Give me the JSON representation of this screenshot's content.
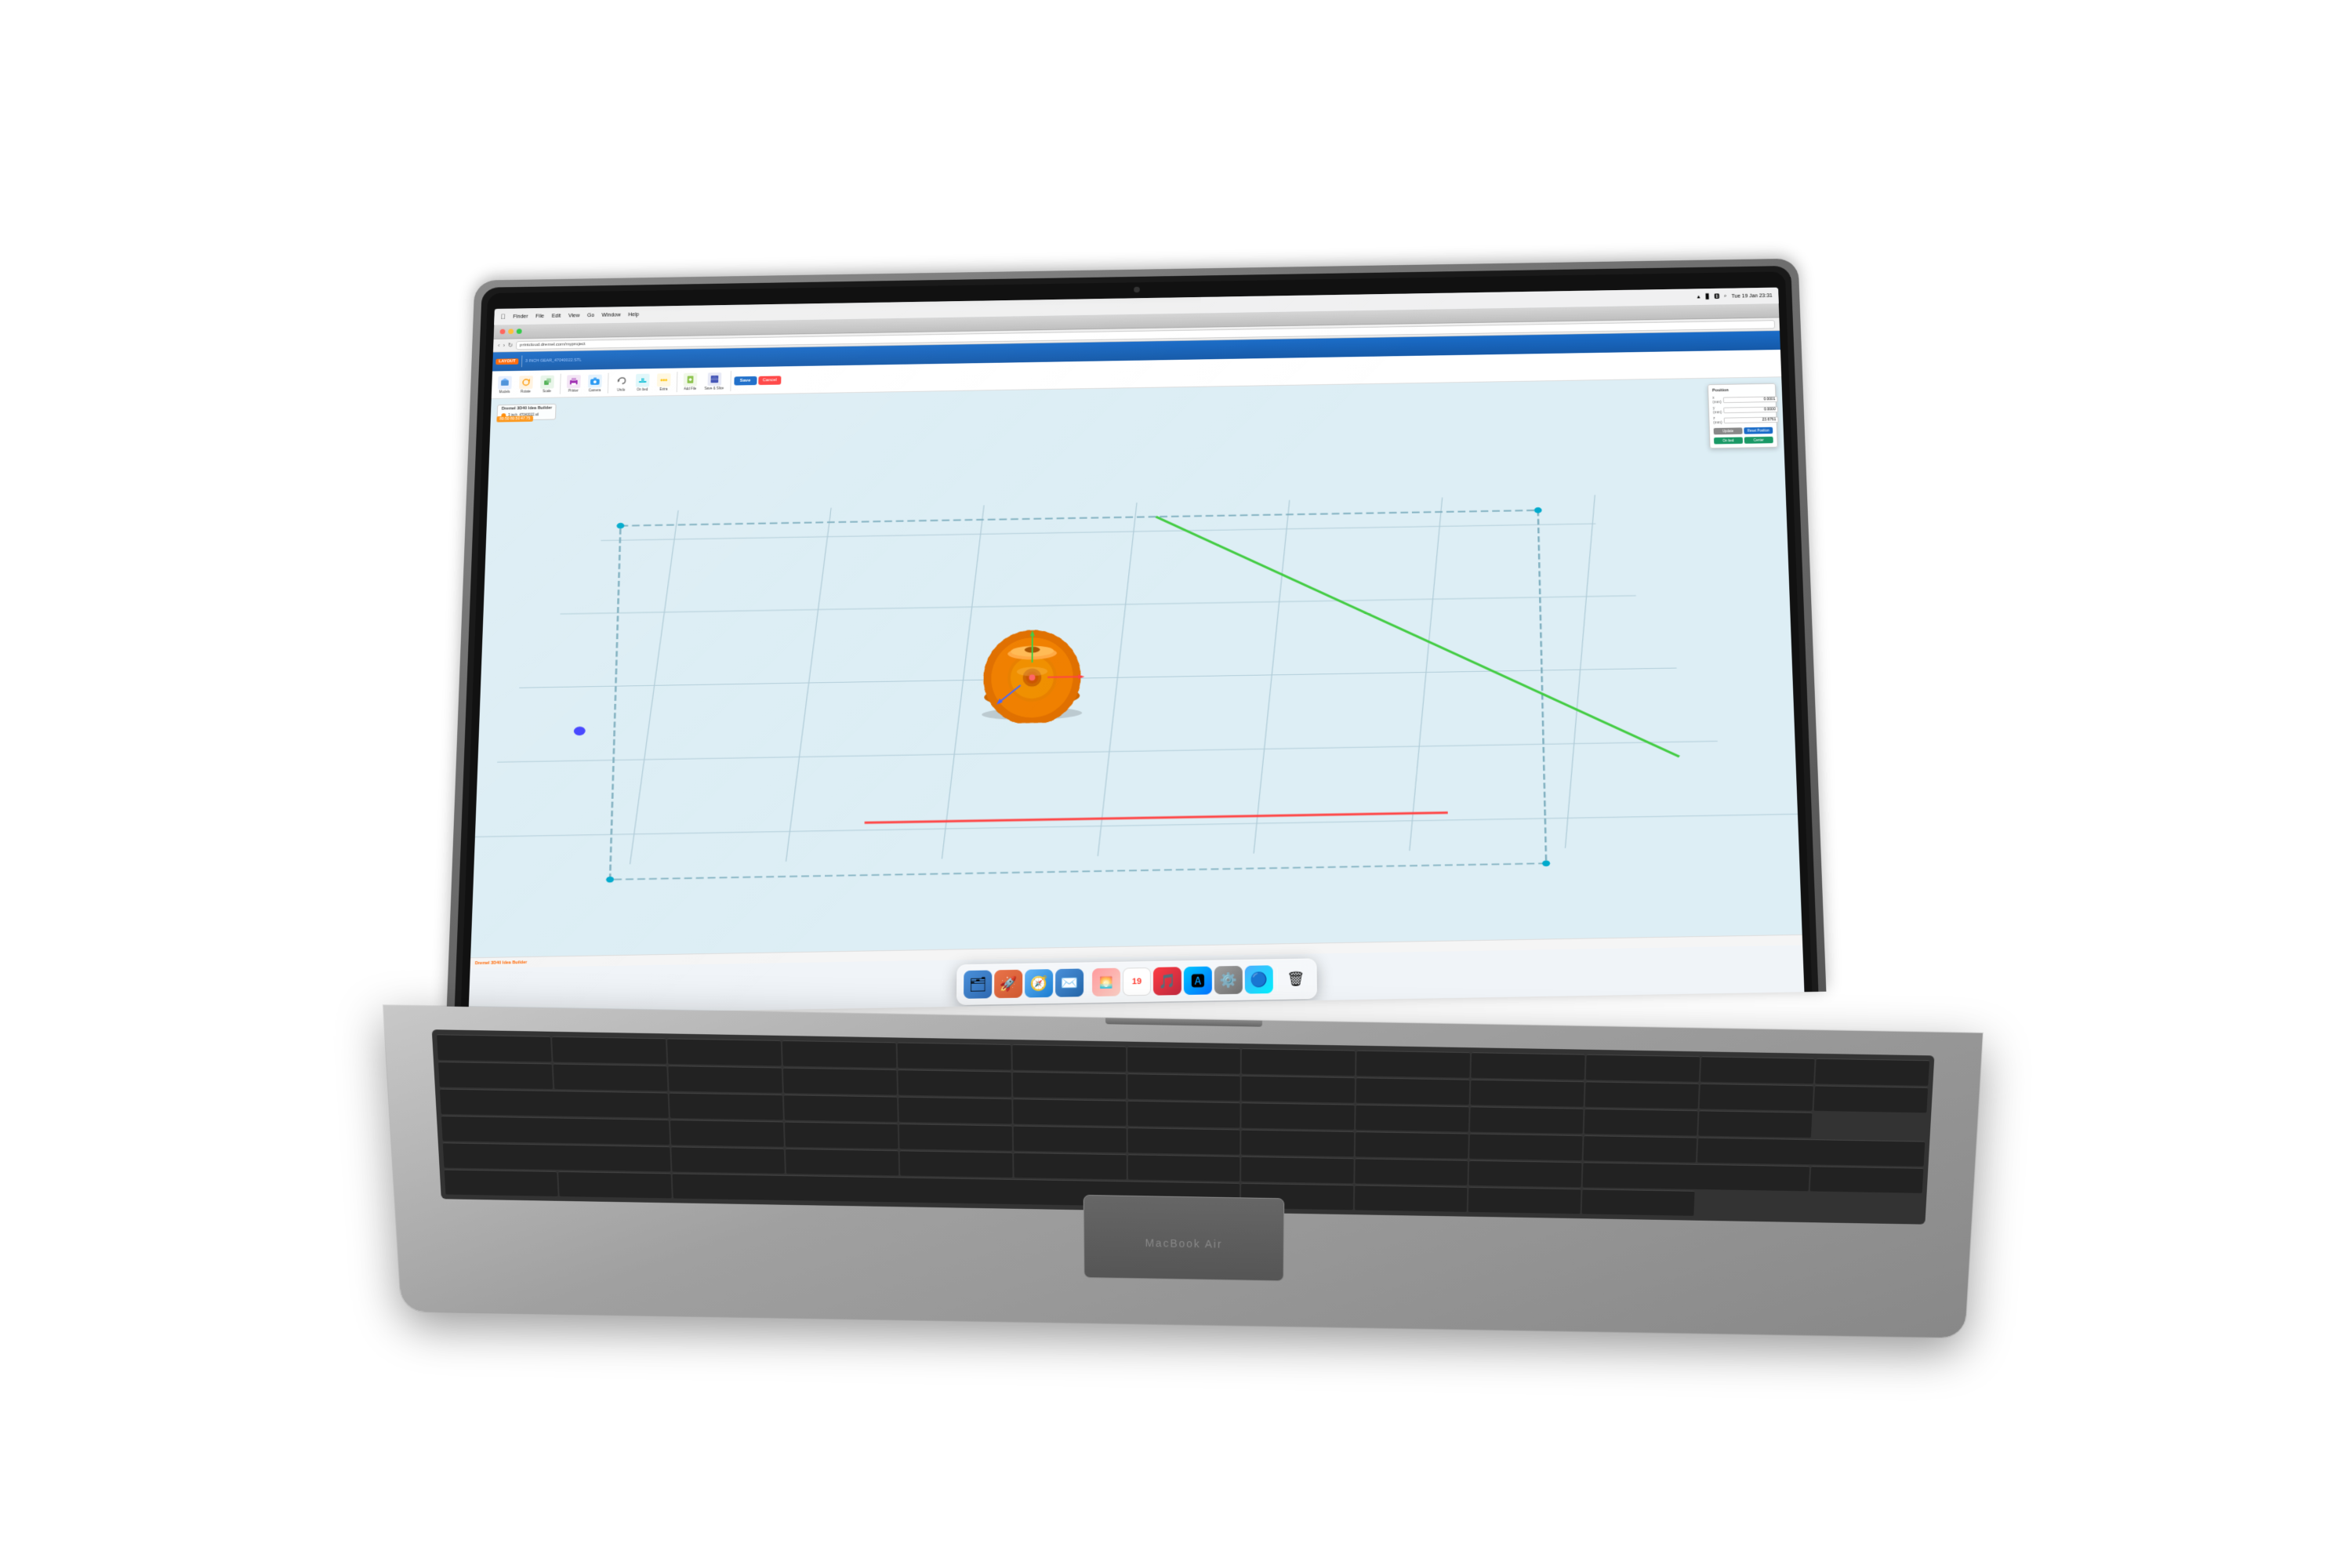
{
  "macbook": {
    "model_label": "MacBook Air",
    "camera_label": "Camera"
  },
  "macos": {
    "time": "Tue 19 Jan 23:31",
    "menubar_items": [
      "Finder",
      "File",
      "Edit",
      "View",
      "Go",
      "Window",
      "Help"
    ],
    "menu_icons": [
      "wifi",
      "battery",
      "bluetooth",
      "search"
    ]
  },
  "browser": {
    "url": "printcloud.dremel.com/myproject",
    "title": "Dremel 3D40 Idea Builder",
    "traffic_lights": [
      "close",
      "minimize",
      "maximize"
    ]
  },
  "dremel_app": {
    "layout_label": "LAYOUT",
    "filename": "3 INCH GEAR_47040022.STL",
    "toolbar_buttons": [
      {
        "id": "models",
        "label": "Models"
      },
      {
        "id": "rotate",
        "label": "Rotate"
      },
      {
        "id": "scale",
        "label": "Scale"
      },
      {
        "id": "printer",
        "label": "Printer"
      },
      {
        "id": "camera",
        "label": "Camera"
      },
      {
        "id": "undo",
        "label": "Undo"
      },
      {
        "id": "on_bed",
        "label": "On bed"
      },
      {
        "id": "extra",
        "label": "Extra"
      },
      {
        "id": "add_file",
        "label": "Add File"
      },
      {
        "id": "save_slice",
        "label": "Save & Slice"
      },
      {
        "id": "save",
        "label": "Save"
      },
      {
        "id": "cancel",
        "label": "Cancel"
      }
    ],
    "position_panel": {
      "title": "Position",
      "x_label": "x (mm)",
      "y_label": "y (mm)",
      "z_label": "z (mm)",
      "x_value": "0.0001",
      "y_value": "0.0000",
      "z_value": "23.6761",
      "update_btn": "Update",
      "preset_btn": "Reset Position",
      "onbed_btn": "On bed",
      "center_btn": "Center"
    },
    "object_name": "3 inch_47040022.stl",
    "dimensions": "80.50  80.50  47.75",
    "builder_bar": "Dremel 3D40 Idea Builder"
  },
  "dock": {
    "icons": [
      {
        "name": "finder",
        "emoji": "🗂",
        "color": "#4a90d9"
      },
      {
        "name": "launchpad",
        "emoji": "🚀",
        "color": "#e8734a"
      },
      {
        "name": "safari",
        "emoji": "🧭",
        "color": "#1a7fd4"
      },
      {
        "name": "mail",
        "emoji": "✉️",
        "color": "#4a90d9"
      },
      {
        "name": "photos",
        "emoji": "🌅",
        "color": "#e8734a"
      },
      {
        "name": "calendar",
        "emoji": "📅",
        "color": "#ff3b30"
      },
      {
        "name": "itunes",
        "emoji": "🎵",
        "color": "#fc3c44"
      },
      {
        "name": "appstore",
        "emoji": "🅰️",
        "color": "#1a7fd4"
      },
      {
        "name": "settings",
        "emoji": "⚙️",
        "color": "#888"
      },
      {
        "name": "finder2",
        "emoji": "📁",
        "color": "#4a90d9"
      },
      {
        "name": "trash",
        "emoji": "🗑",
        "color": "#888"
      }
    ]
  }
}
